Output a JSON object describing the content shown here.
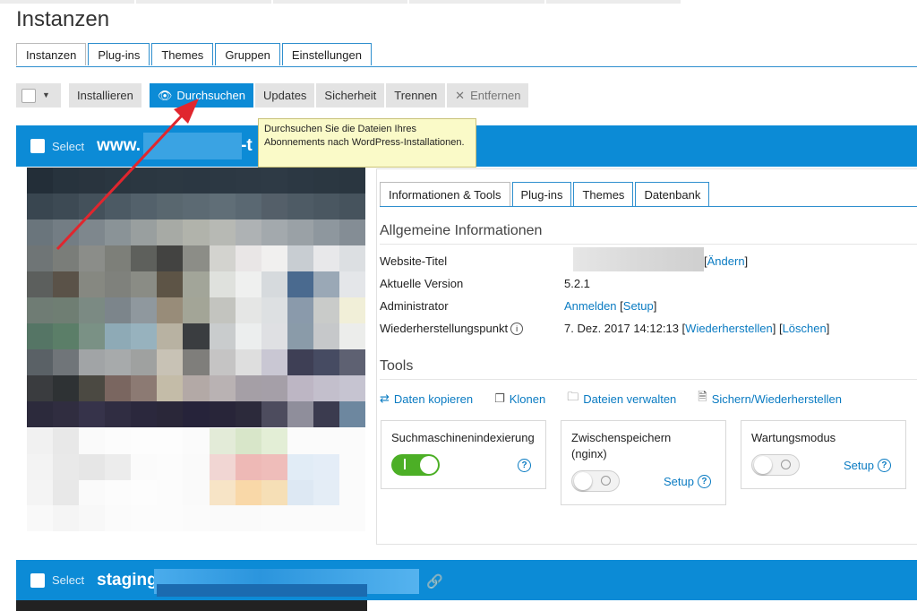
{
  "page": {
    "title": "Instanzen"
  },
  "tabs": [
    {
      "label": "Instanzen",
      "active": true
    },
    {
      "label": "Plug-ins"
    },
    {
      "label": "Themes"
    },
    {
      "label": "Gruppen"
    },
    {
      "label": "Einstellungen"
    }
  ],
  "toolbar": {
    "install": "Installieren",
    "scan": "Durchsuchen",
    "updates": "Updates",
    "security": "Sicherheit",
    "detach": "Trennen",
    "remove": "Entfernen"
  },
  "tooltip": {
    "text": "Durchsuchen Sie die Dateien Ihres Abonnements nach WordPress-Installationen."
  },
  "instance1": {
    "select": "Select",
    "domain_prefix": "www.",
    "domain_suffix": "-t"
  },
  "instance2": {
    "select": "Select",
    "domain_prefix": "staging."
  },
  "detail": {
    "tabs": [
      "Informationen & Tools",
      "Plug-ins",
      "Themes",
      "Datenbank"
    ],
    "general_title": "Allgemeine Informationen",
    "rows": {
      "site_title_label": "Website-Titel",
      "change_link": "Ändern",
      "version_label": "Aktuelle Version",
      "version_value": "5.2.1",
      "admin_label": "Administrator",
      "login_link": "Anmelden",
      "setup_link": "Setup",
      "restore_label": "Wiederherstellungspunkt",
      "restore_date": "7. Dez. 2017 14:12:13",
      "restore_link": "Wiederherstellen",
      "delete_link": "Löschen"
    },
    "tools_title": "Tools",
    "tools": [
      "Daten kopieren",
      "Klonen",
      "Dateien verwalten",
      "Sichern/Wiederherstellen"
    ],
    "cards": {
      "indexing": "Suchmaschinenindexierung",
      "cache_line1": "Zwischenspeichern",
      "cache_line2": "(nginx)",
      "maintenance": "Wartungsmodus",
      "setup": "Setup"
    }
  },
  "colors": {
    "accent": "#0c8bd6",
    "link": "#0a7bc2",
    "toggle_on": "#4caf26",
    "arrow": "#e0262e"
  }
}
